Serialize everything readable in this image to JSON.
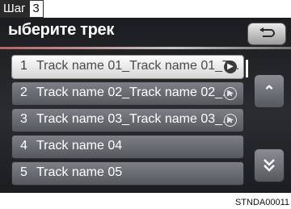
{
  "header": {
    "step_label": "Шаг",
    "step_number": "3"
  },
  "screen": {
    "title": "ыберите трек",
    "back_icon": "return-arrow-icon",
    "scroll_up_icon": "chevron-up-icon",
    "scroll_down_icon": "chevron-down-icon"
  },
  "tracks": [
    {
      "num": "1",
      "name": "Track name 01_Track name 01_T...",
      "selected": true
    },
    {
      "num": "2",
      "name": "Track name 02_Track name 02_...",
      "selected": false
    },
    {
      "num": "3",
      "name": "Track name 03_Track name 03_...",
      "selected": false
    },
    {
      "num": "4",
      "name": "Track name 04",
      "selected": false
    },
    {
      "num": "5",
      "name": "Track name 05",
      "selected": false
    }
  ],
  "figure_code": "STNDA00011",
  "colors": {
    "screen_bg": "#232529",
    "row_bg": "#6a6e74",
    "row_selected_bg": "#f0f0f0",
    "text": "#ffffff"
  }
}
